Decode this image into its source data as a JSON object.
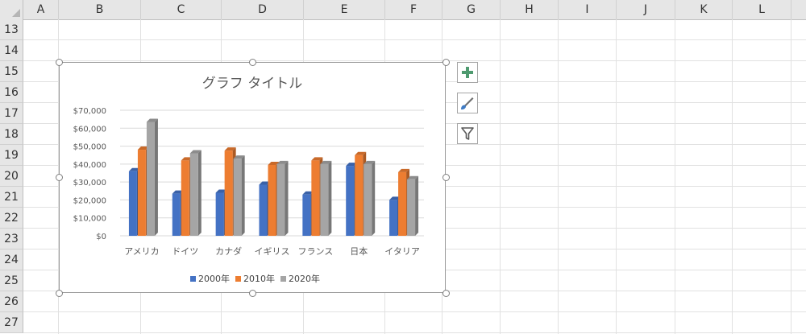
{
  "spreadsheet": {
    "columns": [
      "A",
      "B",
      "C",
      "D",
      "E",
      "F",
      "G",
      "H",
      "I",
      "J",
      "K",
      "L"
    ],
    "rows": [
      "13",
      "14",
      "15",
      "16",
      "17",
      "18",
      "19",
      "20",
      "21",
      "22",
      "23",
      "24",
      "25",
      "26",
      "27"
    ]
  },
  "chart_buttons": [
    {
      "name": "chart-elements",
      "icon": "plus-icon"
    },
    {
      "name": "chart-styles",
      "icon": "paintbrush-icon"
    },
    {
      "name": "chart-filters",
      "icon": "funnel-icon"
    }
  ],
  "colors": {
    "series1": "#4472c4",
    "series2": "#ed7d31",
    "series3": "#a5a5a5",
    "plus": "#4e9a6f"
  },
  "chart_data": {
    "type": "bar",
    "title": "グラフ タイトル",
    "categories": [
      "アメリカ",
      "ドイツ",
      "カナダ",
      "イギリス",
      "フランス",
      "日本",
      "イタリア"
    ],
    "series": [
      {
        "name": "2000年",
        "values": [
          36000,
          23500,
          24000,
          28500,
          23000,
          39000,
          20000
        ]
      },
      {
        "name": "2010年",
        "values": [
          48000,
          42000,
          47500,
          39500,
          42000,
          45000,
          35500
        ]
      },
      {
        "name": "2020年",
        "values": [
          63500,
          46000,
          43000,
          40000,
          40000,
          40000,
          31500
        ]
      }
    ],
    "y_ticks": [
      "$0",
      "$10,000",
      "$20,000",
      "$30,000",
      "$40,000",
      "$50,000",
      "$60,000",
      "$70,000"
    ],
    "ylim": [
      0,
      70000
    ],
    "grid": true,
    "legend": "bottom"
  }
}
